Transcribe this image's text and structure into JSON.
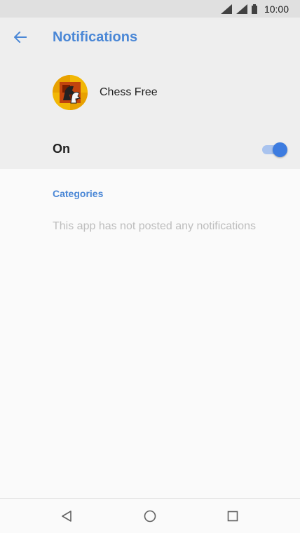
{
  "status_bar": {
    "time": "10:00",
    "icons": [
      "wifi-signal-icon",
      "cell-signal-icon",
      "battery-icon"
    ]
  },
  "toolbar": {
    "back_icon": "arrow-back-icon",
    "title": "Notifications"
  },
  "app": {
    "name": "Chess Free",
    "icon": "chess-app-icon"
  },
  "toggle": {
    "label": "On",
    "state": true,
    "accent_color": "#3d7ce0"
  },
  "categories": {
    "header": "Categories",
    "empty_message": "This app has not posted any notifications"
  },
  "nav_bar": {
    "icons": [
      "back-triangle-icon",
      "home-circle-icon",
      "recents-square-icon"
    ]
  },
  "colors": {
    "accent": "#4a87d6",
    "header_bg": "#eeeeee",
    "body_bg": "#fafafa"
  }
}
